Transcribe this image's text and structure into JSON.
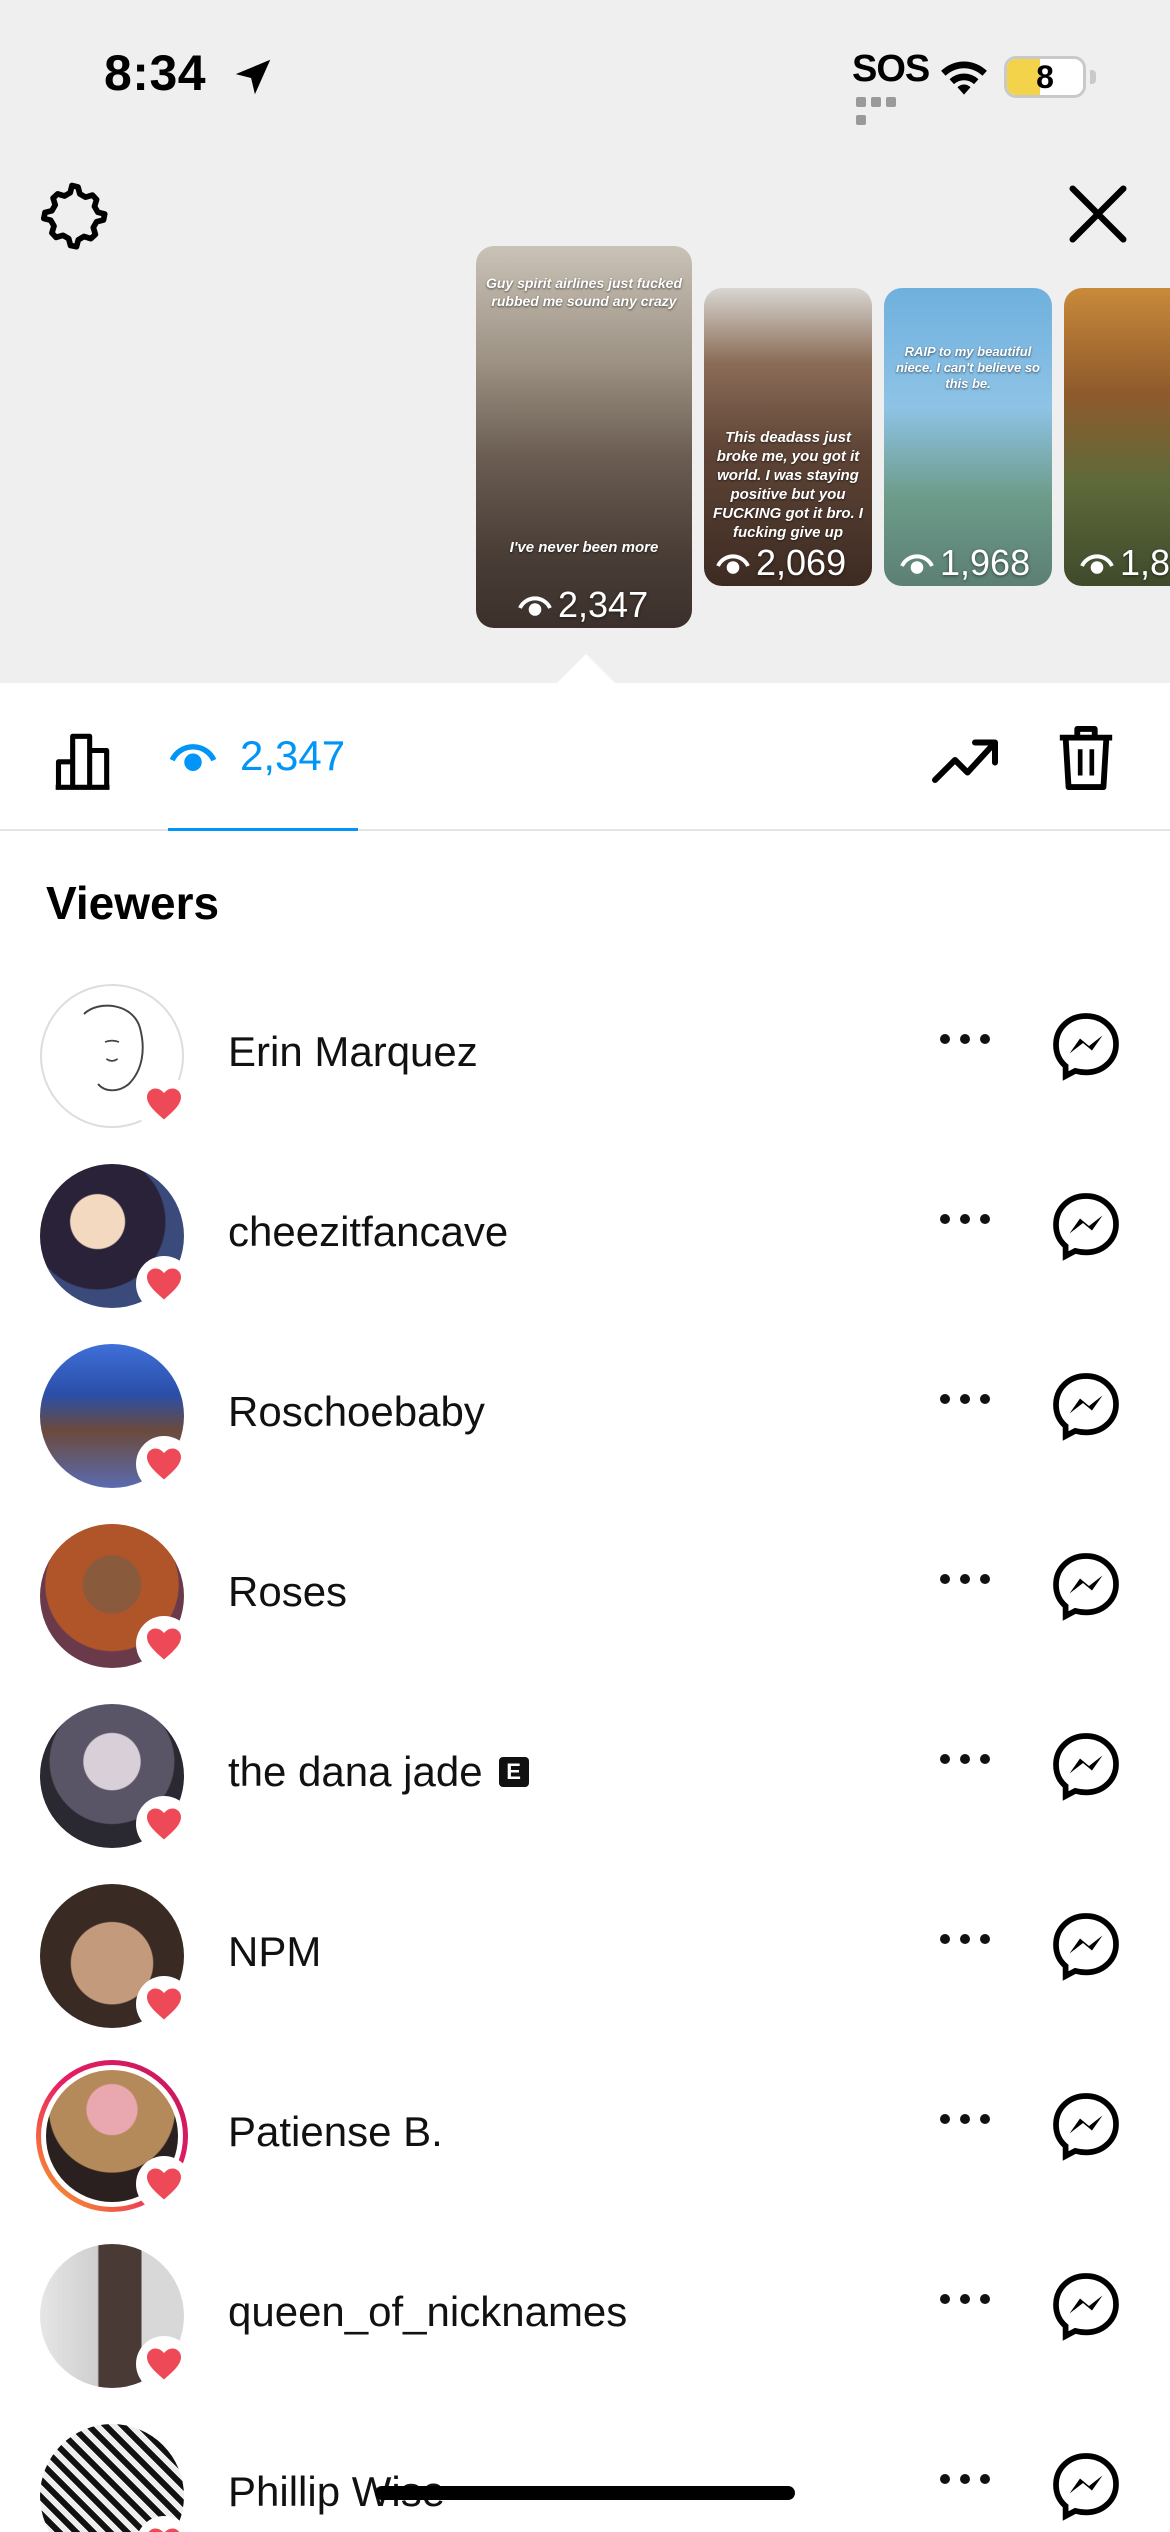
{
  "status_bar": {
    "time": "8:34",
    "sos": "SOS",
    "battery": "8",
    "battery_level": 0.08
  },
  "stories": [
    {
      "views": "2,347",
      "selected": true,
      "caption_top": "Guy spirit airlines just fucked rubbed me sound any crazy",
      "caption_bottom": "I've never been more"
    },
    {
      "views": "2,069",
      "selected": false,
      "caption": "This deadass just broke me, you got it world. I was staying positive but you FUCKING got it bro. I fucking give up"
    },
    {
      "views": "1,968",
      "selected": false,
      "caption": "RAIP to my beautiful niece. I can't believe so this be."
    },
    {
      "views": "1,8",
      "selected": false
    }
  ],
  "toolbar": {
    "views_count": "2,347"
  },
  "viewers_title": "Viewers",
  "viewers": [
    {
      "name": "Erin Marquez",
      "liked": true,
      "story_ring": false
    },
    {
      "name": "cheezitfancave",
      "liked": true,
      "story_ring": false
    },
    {
      "name": "Roschoebaby",
      "liked": true,
      "story_ring": false
    },
    {
      "name": "Roses",
      "liked": true,
      "story_ring": false
    },
    {
      "name": "the dana jade",
      "liked": true,
      "story_ring": false,
      "badge": "E"
    },
    {
      "name": "NPM",
      "liked": true,
      "story_ring": false
    },
    {
      "name": "Patiense B.",
      "liked": true,
      "story_ring": true
    },
    {
      "name": "queen_of_nicknames",
      "liked": true,
      "story_ring": false
    },
    {
      "name": "Phillip Wise",
      "liked": true,
      "story_ring": false
    }
  ],
  "colors": {
    "accent": "#0095f6",
    "heart": "#ed4956",
    "top_bg": "#efefef"
  }
}
